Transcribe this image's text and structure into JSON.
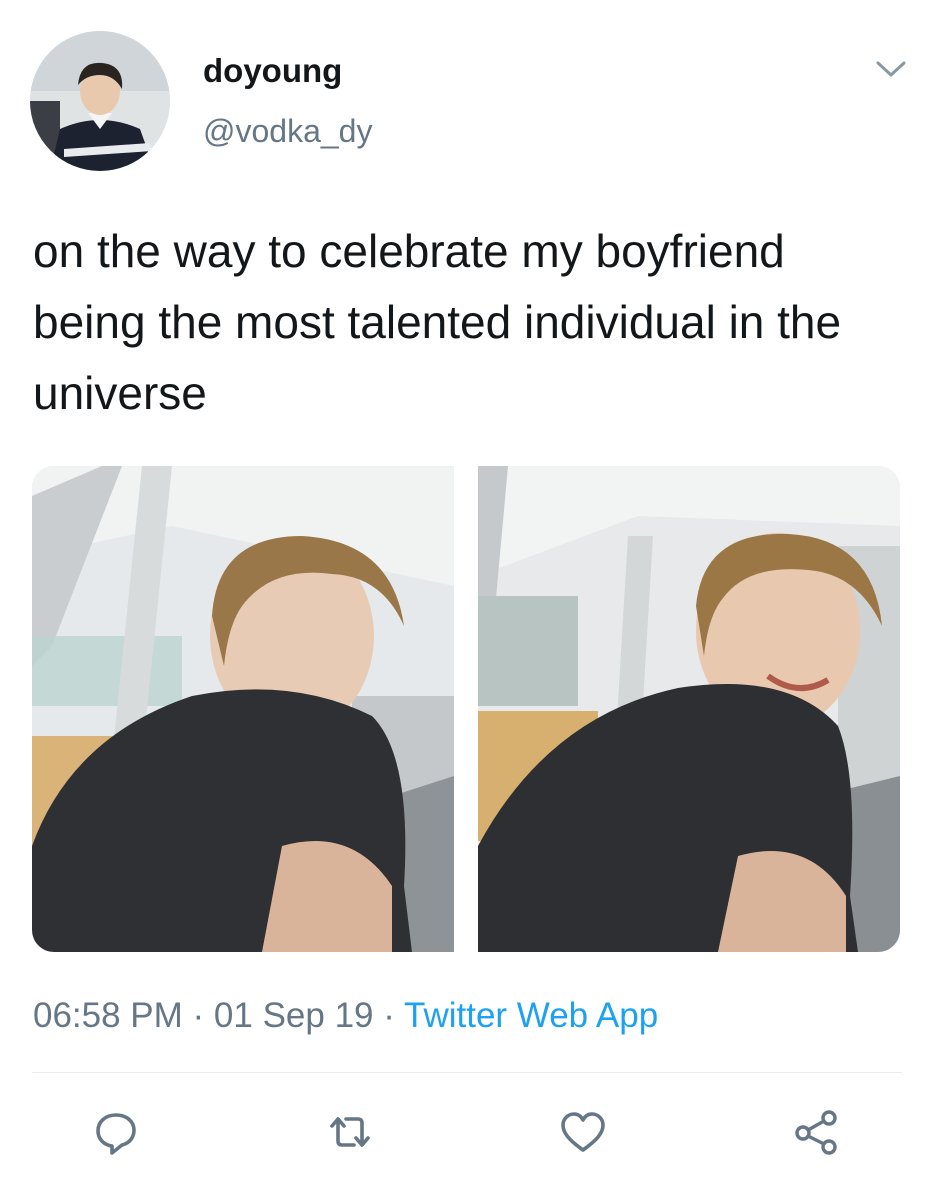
{
  "author": {
    "display_name": "doyoung",
    "handle": "@vodka_dy",
    "avatar_icon": "profile-photo"
  },
  "tweet": {
    "text": "on the way to celebrate my boyfriend being the most talented individual in the universe",
    "images": [
      {
        "alt": "photo-1"
      },
      {
        "alt": "photo-2"
      }
    ]
  },
  "meta": {
    "time": "06:58 PM",
    "separator": " · ",
    "date": "01 Sep 19",
    "source": "Twitter Web App"
  },
  "actions": {
    "reply_icon": "reply-icon",
    "retweet_icon": "retweet-icon",
    "like_icon": "heart-icon",
    "share_icon": "share-icon"
  },
  "colors": {
    "text": "#14171a",
    "secondary": "#657786",
    "link": "#1da1f2",
    "icon": "#657786",
    "divider": "#e6ecf0"
  }
}
